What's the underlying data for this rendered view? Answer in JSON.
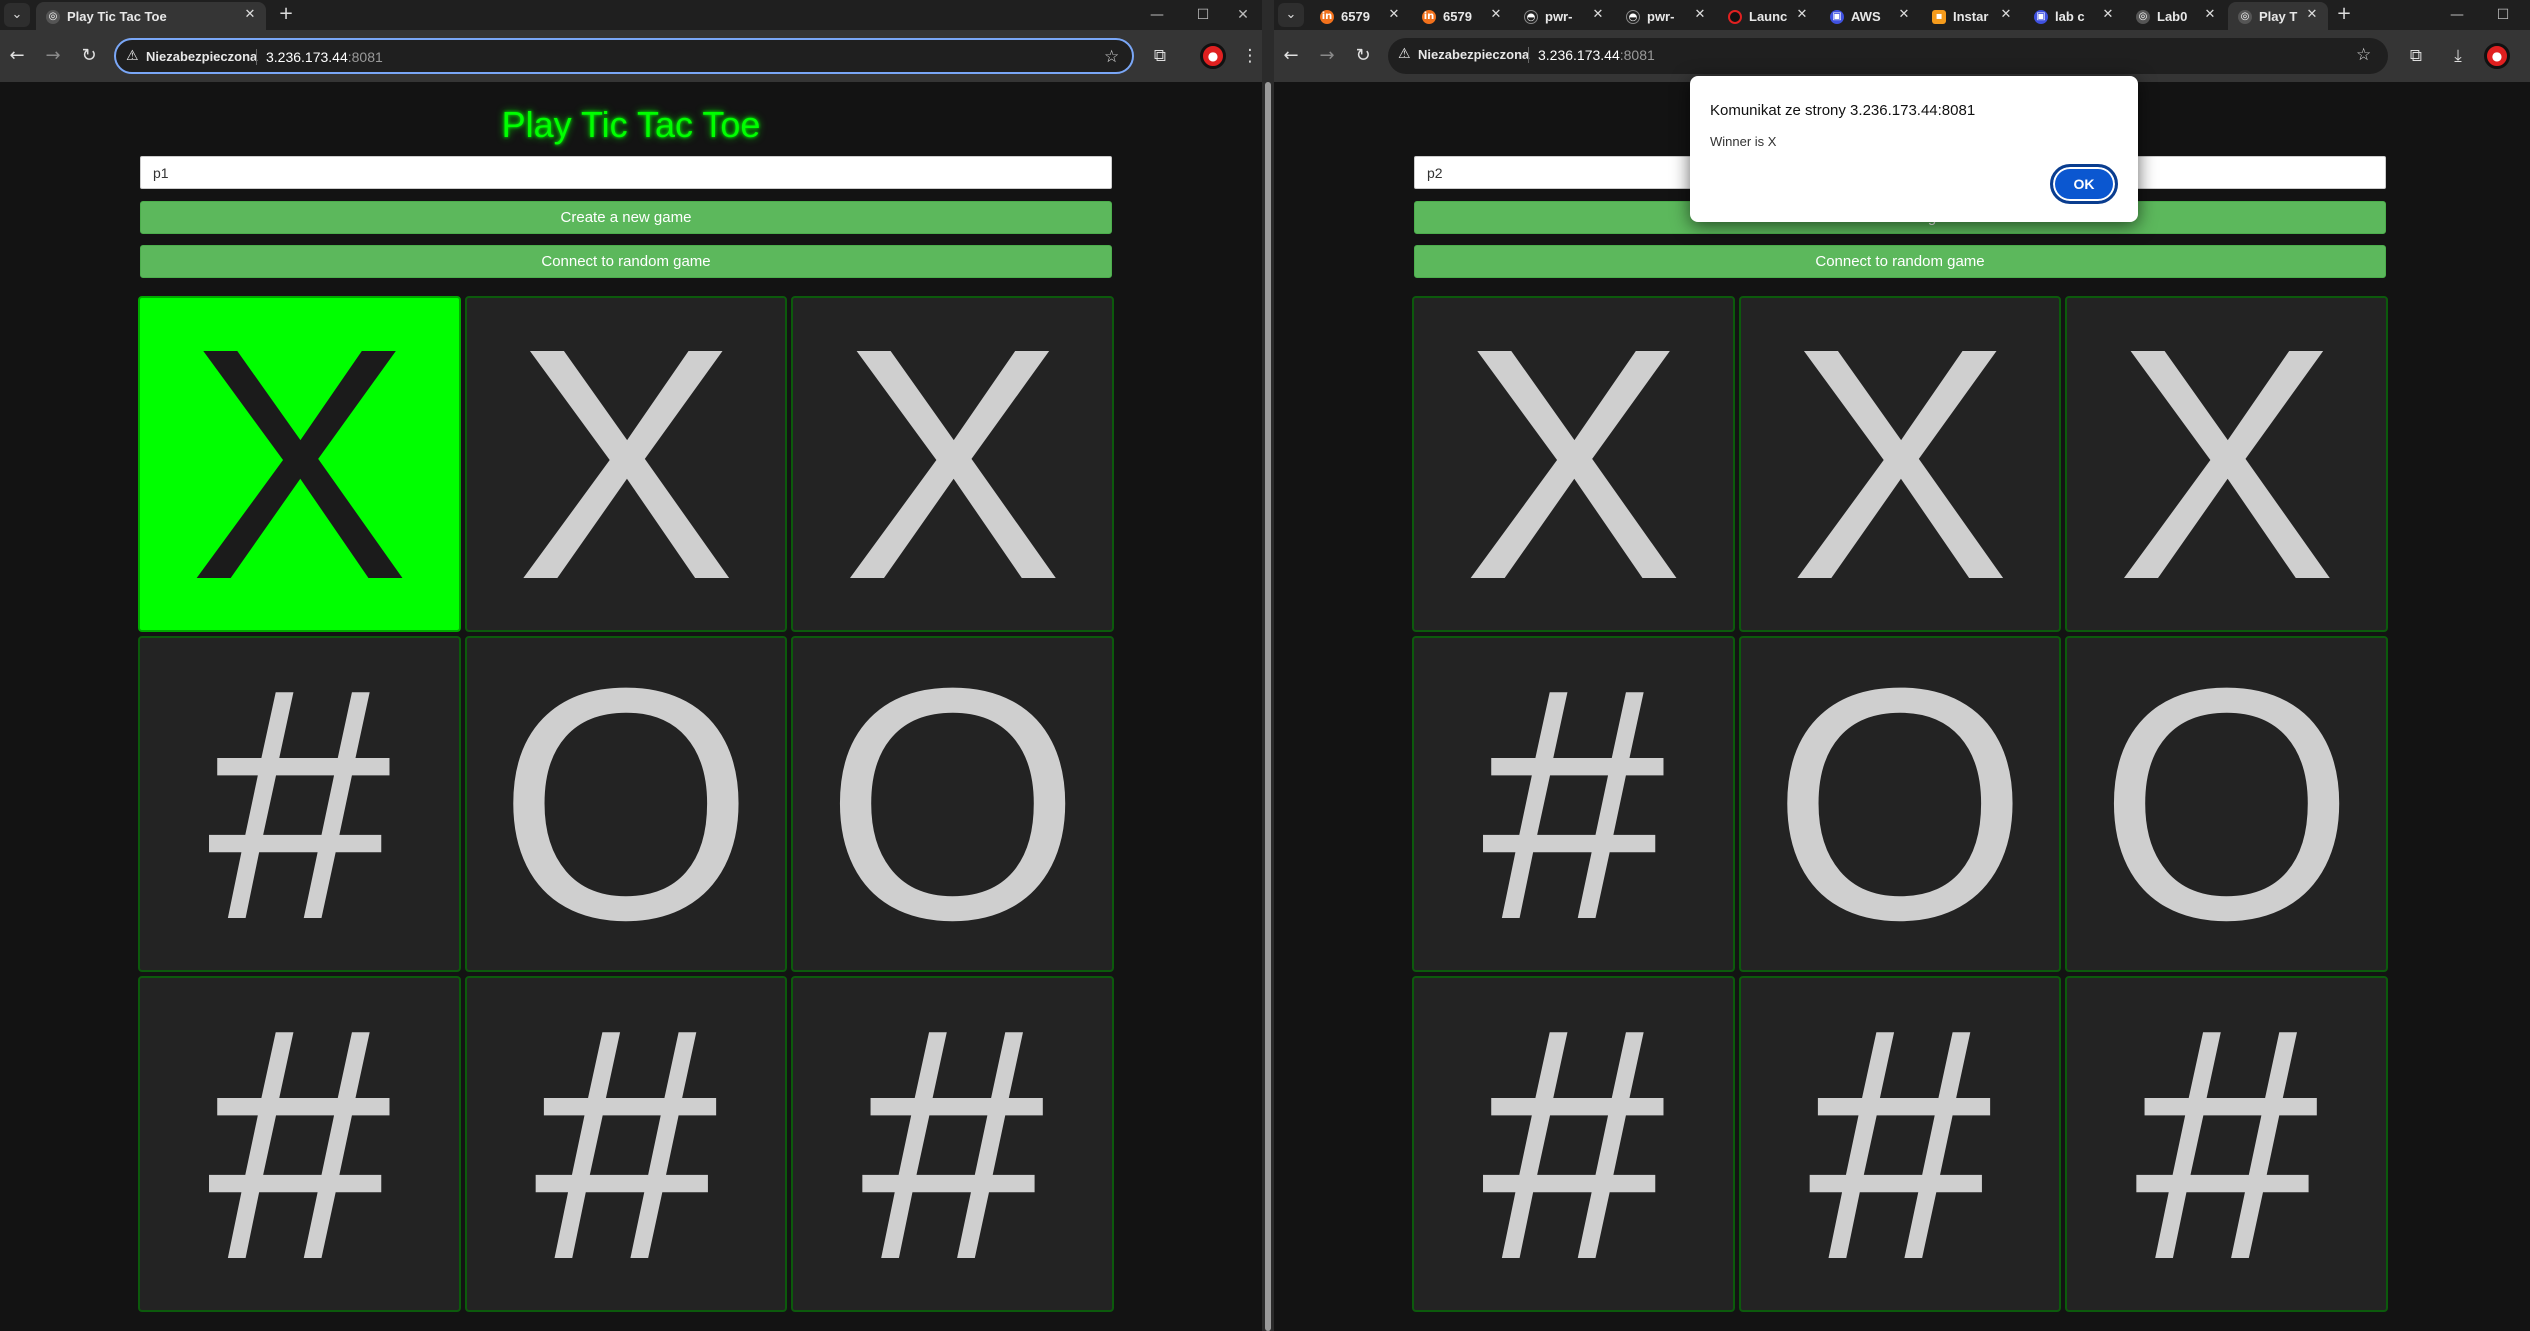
{
  "left_window": {
    "tab_menu_glyph": "⌄",
    "tabs": [
      {
        "label": "Play Tic Tac Toe",
        "favicon": "globe-icon",
        "active": true
      }
    ],
    "new_tab_glyph": "+",
    "window_controls": [
      "—",
      "☐",
      "✕"
    ],
    "toolbar": {
      "back": "←",
      "forward": "→",
      "reload": "↻",
      "security_warning_icon": "⚠",
      "security_label": "Niezabezpieczona",
      "url_host": "3.236.173.44",
      "url_port": ":8081",
      "bookmark_star": "☆",
      "extensions_icon": "⧉",
      "profile_badge": "●",
      "menu_icon": "⋮"
    },
    "page": {
      "title": "Play Tic Tac Toe",
      "name_input_value": "p1",
      "create_button": "Create a new game",
      "connect_button": "Connect to random game",
      "board": [
        "X",
        "X",
        "X",
        "#",
        "O",
        "O",
        "#",
        "#",
        "#"
      ],
      "highlighted_cell_index": 0,
      "highlight_color": "#00ff00"
    }
  },
  "right_window": {
    "tab_menu_glyph": "⌄",
    "tabs": [
      {
        "label": "6579",
        "favicon": "in-icon",
        "active": false
      },
      {
        "label": "6579",
        "favicon": "in-icon",
        "active": false
      },
      {
        "label": "pwr-",
        "favicon": "github-icon",
        "active": false
      },
      {
        "label": "pwr-",
        "favicon": "github-icon",
        "active": false
      },
      {
        "label": "Launc",
        "favicon": "launch-icon",
        "active": false
      },
      {
        "label": "AWS",
        "favicon": "aws-icon",
        "active": false
      },
      {
        "label": "Instar",
        "favicon": "instance-icon",
        "active": false
      },
      {
        "label": "lab c",
        "favicon": "lab-icon",
        "active": false
      },
      {
        "label": "Lab0",
        "favicon": "globe-icon",
        "active": false
      },
      {
        "label": "Play T",
        "favicon": "globe-icon",
        "active": true
      }
    ],
    "new_tab_glyph": "+",
    "window_controls": [
      "—",
      "☐"
    ],
    "toolbar": {
      "back": "←",
      "forward": "→",
      "reload": "↻",
      "security_warning_icon": "⚠",
      "security_label": "Niezabezpieczona",
      "url_host": "3.236.173.44",
      "url_port": ":8081",
      "bookmark_star": "☆",
      "extensions_icon": "⧉",
      "download_icon": "⤓",
      "profile_badge": "●"
    },
    "page": {
      "name_input_value": "p2",
      "create_button": "Create a new game",
      "connect_button": "Connect to random game",
      "board": [
        "X",
        "X",
        "X",
        "#",
        "O",
        "O",
        "#",
        "#",
        "#"
      ]
    },
    "alert_dialog": {
      "title": "Komunikat ze strony 3.236.173.44:8081",
      "message": "Winner is X",
      "ok_label": "OK"
    }
  }
}
